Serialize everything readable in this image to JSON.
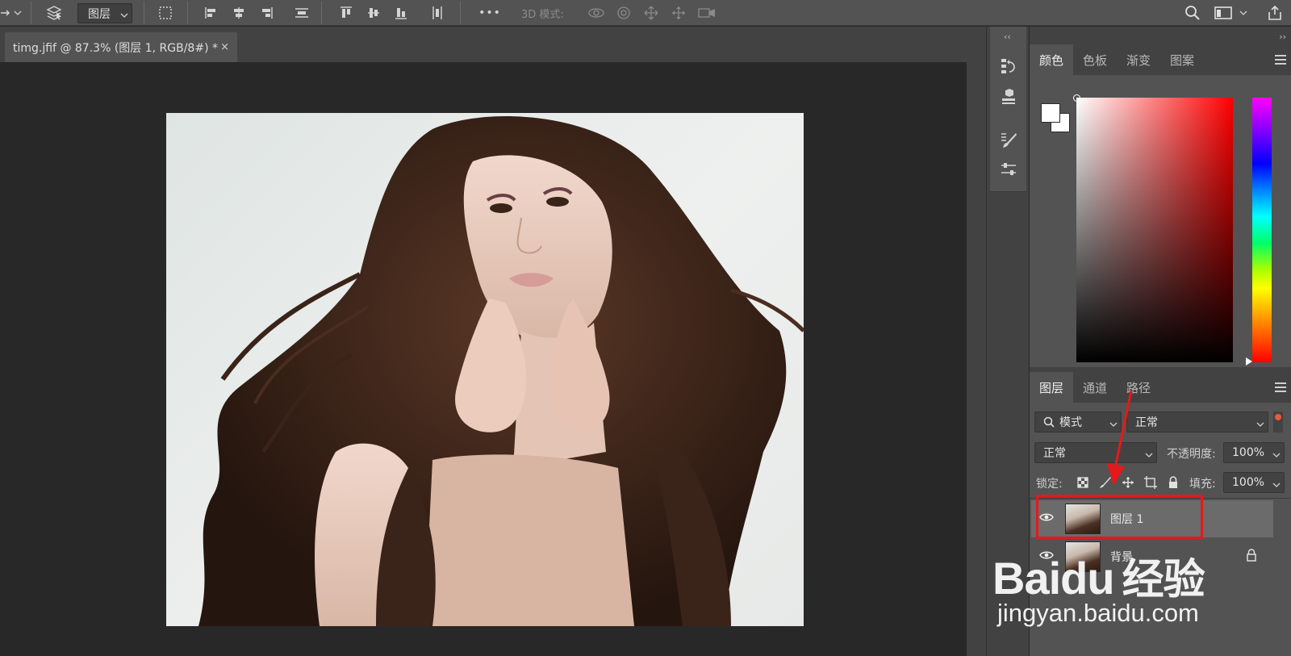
{
  "options_bar": {
    "arrange_dropdown": "图层",
    "mode_3d_label": "3D 模式:",
    "more_label": "•••"
  },
  "document_tab": {
    "title": "timg.jfif @ 87.3% (图层 1, RGB/8#) *",
    "close": "×"
  },
  "color_panel": {
    "tabs": [
      "颜色",
      "色板",
      "渐变",
      "图案"
    ],
    "active_tab": 0,
    "field_hue": "#ff0000"
  },
  "layers_panel": {
    "tabs": [
      "图层",
      "通道",
      "路径"
    ],
    "active_tab": 0,
    "filter_kind": "模式",
    "filter_mode": "正常",
    "blend_mode": "正常",
    "opacity_label": "不透明度:",
    "opacity_value": "100%",
    "lock_label": "锁定:",
    "fill_label": "填充:",
    "fill_value": "100%",
    "layers": [
      {
        "name": "图层 1",
        "selected": true,
        "locked": false
      },
      {
        "name": "背景",
        "selected": false,
        "locked": true
      }
    ]
  },
  "annotation": {
    "color": "#e4191c"
  },
  "watermark": {
    "brand_a": "Bai",
    "brand_b": "du",
    "brand_cn": "经验",
    "url": "jingyan.baidu.com"
  }
}
